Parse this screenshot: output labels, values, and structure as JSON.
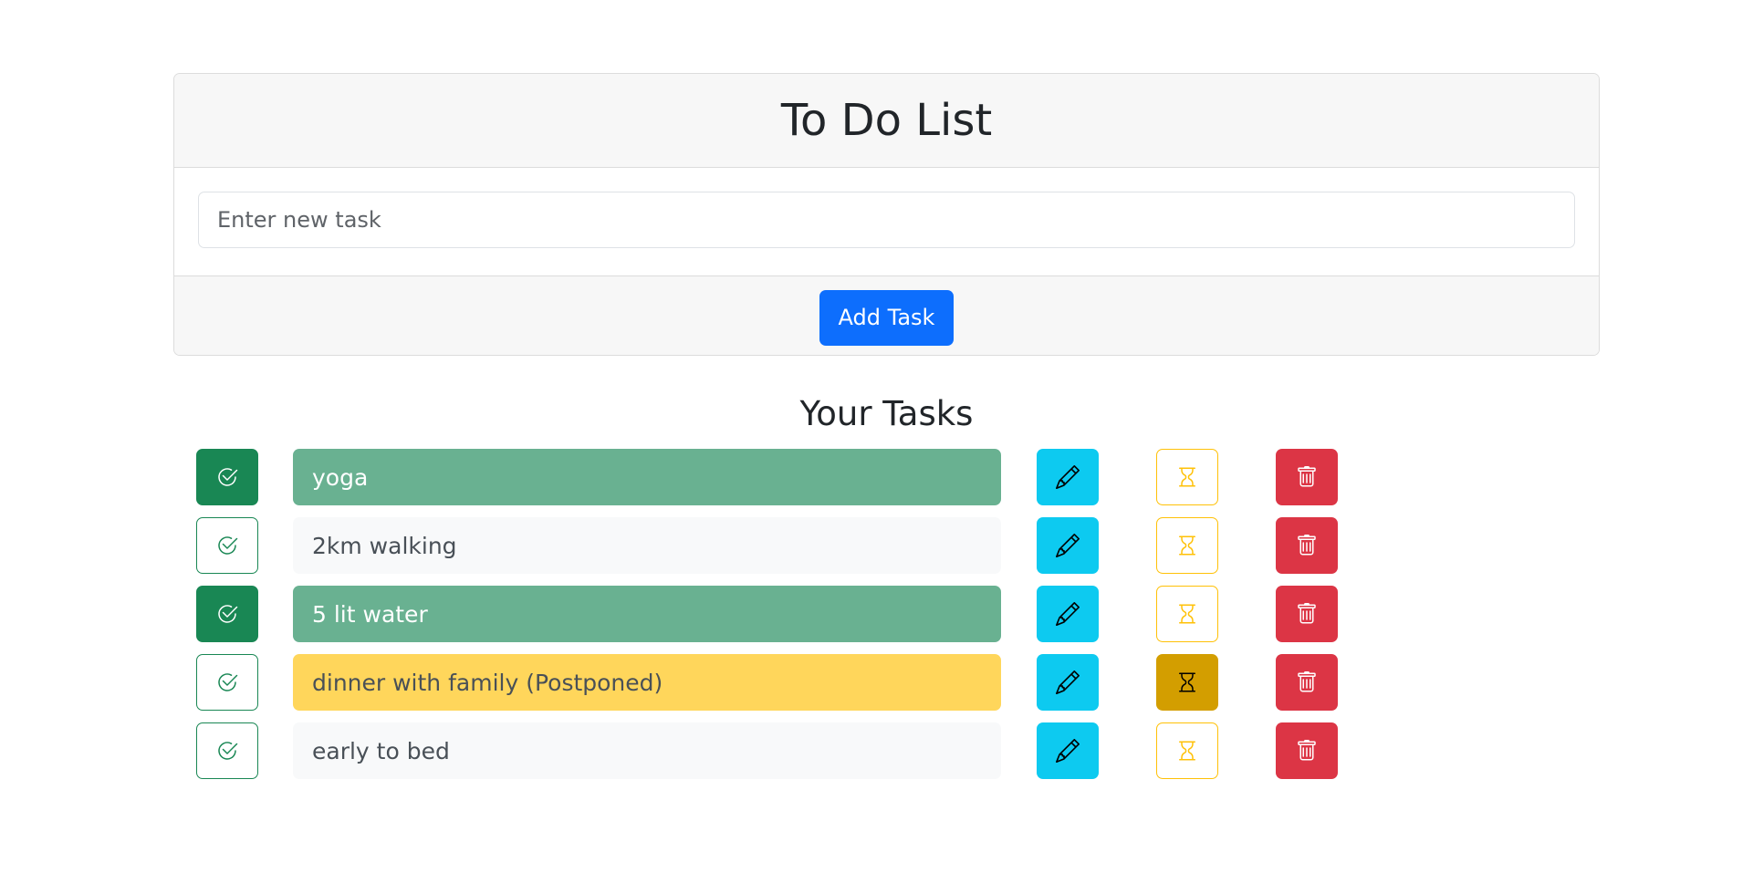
{
  "header": {
    "title": "To Do List"
  },
  "new_task": {
    "placeholder": "Enter new task",
    "value": ""
  },
  "add_button": {
    "label": "Add Task"
  },
  "tasks_section": {
    "title": "Your Tasks"
  },
  "icons": {
    "complete": "check-circle-icon",
    "edit": "pencil-icon",
    "postpone": "hourglass-icon",
    "delete": "trash-icon"
  },
  "colors": {
    "primary": "#0d6efd",
    "success": "#198754",
    "info": "#0dcaf0",
    "warning": "#ffc107",
    "danger": "#dc3545"
  },
  "tasks": [
    {
      "text": "yoga",
      "completed": true,
      "postponed": false
    },
    {
      "text": "2km walking",
      "completed": false,
      "postponed": false
    },
    {
      "text": "5 lit water",
      "completed": true,
      "postponed": false
    },
    {
      "text": "dinner with family (Postponed)",
      "completed": false,
      "postponed": true
    },
    {
      "text": "early to bed",
      "completed": false,
      "postponed": false
    }
  ]
}
